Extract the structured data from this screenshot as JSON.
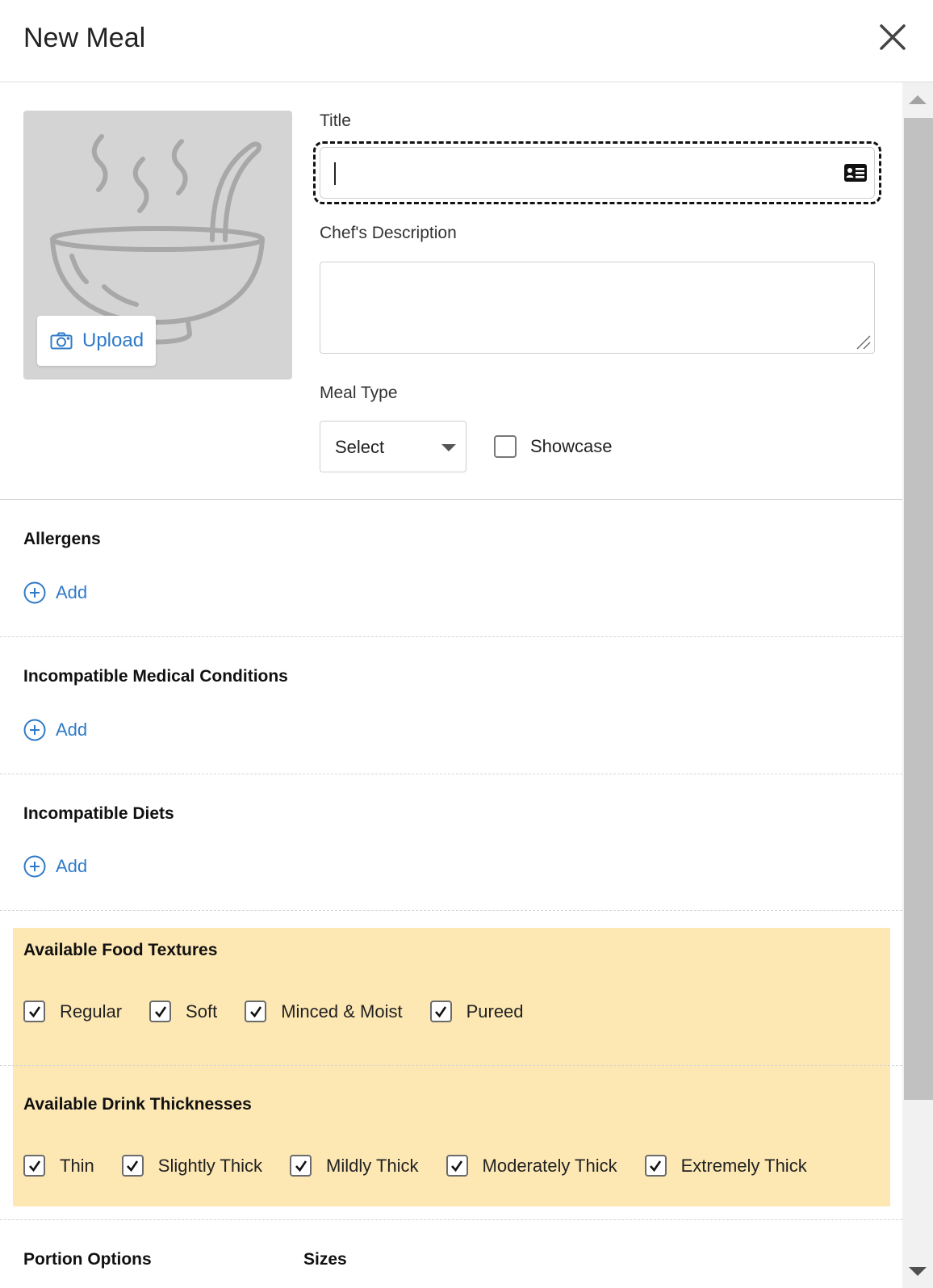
{
  "header": {
    "title": "New Meal",
    "close_icon": "close-icon"
  },
  "photo": {
    "placeholder_icon": "soup-bowl-icon",
    "upload_label": "Upload",
    "upload_icon": "camera-icon"
  },
  "form": {
    "title_label": "Title",
    "title_value": "",
    "title_icon": "contact-card-icon",
    "description_label": "Chef's Description",
    "description_value": "",
    "meal_type_label": "Meal Type",
    "meal_type_value": "Select",
    "showcase_label": "Showcase",
    "showcase_checked": false
  },
  "sections": {
    "allergens": {
      "title": "Allergens",
      "add_label": "Add"
    },
    "medical": {
      "title": "Incompatible Medical Conditions",
      "add_label": "Add"
    },
    "diets": {
      "title": "Incompatible Diets",
      "add_label": "Add"
    }
  },
  "textures": {
    "title": "Available Food Textures",
    "highlight_color": "#fde8b4",
    "items": [
      {
        "label": "Regular",
        "checked": true
      },
      {
        "label": "Soft",
        "checked": true
      },
      {
        "label": "Minced & Moist",
        "checked": true
      },
      {
        "label": "Pureed",
        "checked": true
      }
    ]
  },
  "thickness": {
    "title": "Available Drink Thicknesses",
    "items": [
      {
        "label": "Thin",
        "checked": true
      },
      {
        "label": "Slightly Thick",
        "checked": true
      },
      {
        "label": "Mildly Thick",
        "checked": true
      },
      {
        "label": "Moderately Thick",
        "checked": true
      },
      {
        "label": "Extremely Thick",
        "checked": true
      }
    ]
  },
  "portion": {
    "title": "Portion Options",
    "sizes_label": "Sizes"
  },
  "colors": {
    "accent": "#2f7ac8",
    "text": "#1b1b1b"
  }
}
